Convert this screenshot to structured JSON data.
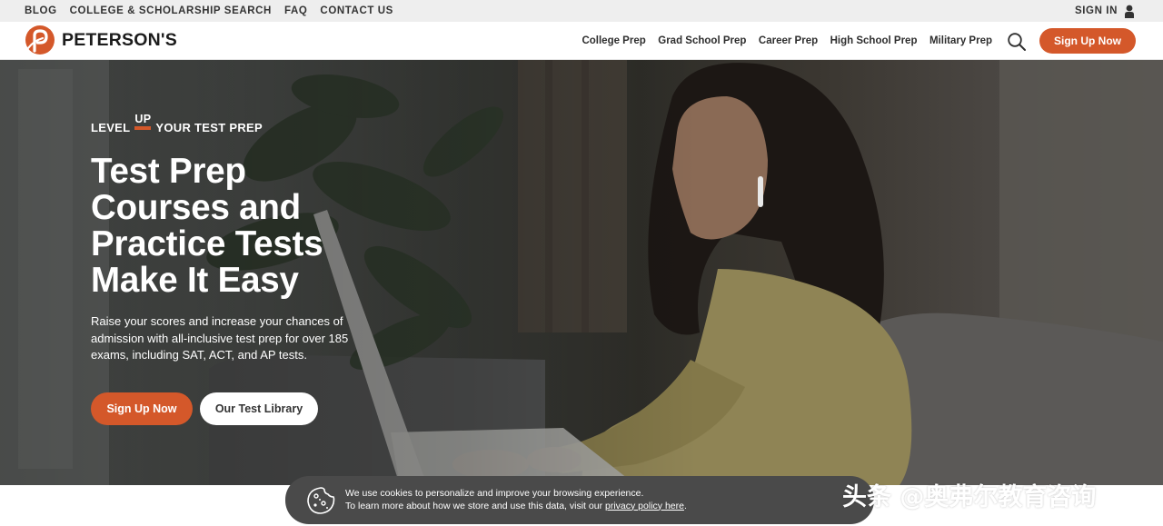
{
  "utility_bar": {
    "links": [
      "BLOG",
      "COLLEGE & SCHOLARSHIP SEARCH",
      "FAQ",
      "CONTACT US"
    ],
    "sign_in": "SIGN IN",
    "sign_in_icon": "user-icon"
  },
  "header": {
    "logo_text": "PETERSON'S",
    "logo_icon": "petersons-logo-mark",
    "nav": [
      "College Prep",
      "Grad School Prep",
      "Career Prep",
      "High School Prep",
      "Military Prep"
    ],
    "search_icon": "search-icon",
    "cta": "Sign Up Now"
  },
  "hero": {
    "eyebrow_before": "LEVEL",
    "eyebrow_up": "UP",
    "eyebrow_after": "YOUR TEST PREP",
    "title_lines": [
      "Test Prep",
      "Courses and",
      "Practice Tests",
      "Make It Easy"
    ],
    "subtitle": "Raise your scores and increase your chances of admission with all-inclusive test prep for over 185 exams, including SAT, ACT, and AP tests.",
    "primary_cta": "Sign Up Now",
    "secondary_cta": "Our Test Library"
  },
  "cookie_banner": {
    "icon": "cookie-icon",
    "line1": "We use cookies to personalize and improve your browsing experience.",
    "line2_prefix": "To learn more about how we store and use this data, visit our ",
    "link_text": "privacy policy here",
    "line2_suffix": "."
  },
  "watermark": "头条 @奥弗尔教育咨询",
  "colors": {
    "accent": "#d4582a",
    "utility_bar_bg": "#eeeeee",
    "cookie_bg": "#4a4a4a"
  }
}
